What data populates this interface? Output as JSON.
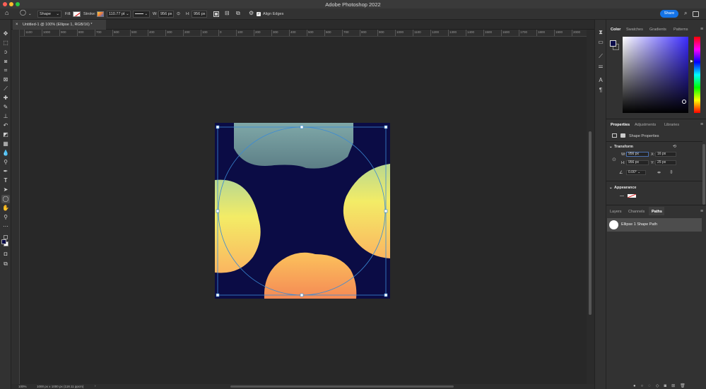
{
  "app": {
    "title": "Adobe Photoshop 2022"
  },
  "options": {
    "mode": "Shape",
    "fill_label": "Fill:",
    "stroke_label": "Stroke:",
    "stroke_width": "110.77 pt",
    "w_label": "W:",
    "w_value": "956 px",
    "h_label": "H:",
    "h_value": "956 px",
    "align_edges": "Align Edges",
    "share": "Share"
  },
  "document": {
    "tab_label": "Untitled-1 @ 100% (Ellipse 1, RGB/16) *",
    "zoom": "100%",
    "status": "1000 px x 1000 px (118.11 ppcm)"
  },
  "ruler": {
    "h_ticks": [
      "1100",
      "1000",
      "900",
      "800",
      "700",
      "600",
      "500",
      "400",
      "300",
      "200",
      "100",
      "0",
      "100",
      "200",
      "300",
      "400",
      "500",
      "600",
      "700",
      "800",
      "900",
      "1000",
      "1100",
      "1200",
      "1300",
      "1400",
      "1500",
      "1600",
      "1700",
      "1800",
      "1900",
      "2000"
    ]
  },
  "color_panel": {
    "tabs": [
      "Color",
      "Swatches",
      "Gradients",
      "Patterns"
    ],
    "foreground": "#0b0c4a",
    "background": "#ffffff"
  },
  "properties_panel": {
    "tabs": [
      "Properties",
      "Adjustments",
      "Libraries"
    ],
    "shape_label": "Shape Properties",
    "transform_head": "Transform",
    "w_label": "W:",
    "w_value": "956 px",
    "x_label": "X:",
    "x_value": "16 px",
    "h_label": "H:",
    "h_value": "956 px",
    "y_label": "Y:",
    "y_value": "25 px",
    "angle_value": "0.00°",
    "appearance_head": "Appearance"
  },
  "paths_panel": {
    "tabs": [
      "Layers",
      "Channels",
      "Paths"
    ],
    "path_name": "Ellipse 1 Shape Path"
  },
  "canvas": {
    "bg_color": "#0b0c45",
    "guide_color": "#3a8ad6"
  }
}
